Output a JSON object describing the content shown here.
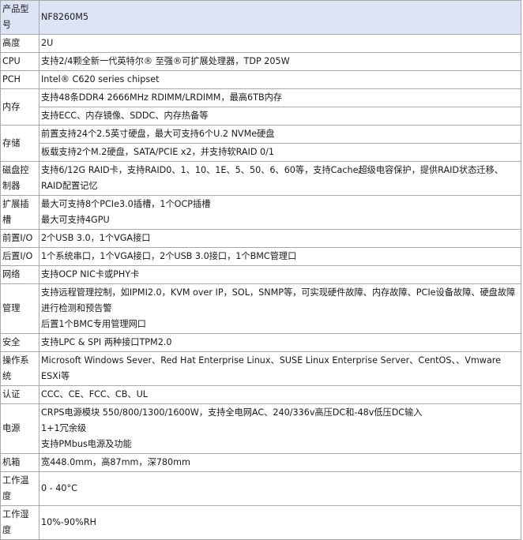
{
  "header": {
    "label": "产品型号",
    "value": "NF8260M5"
  },
  "rows": [
    {
      "label": "高度",
      "cells": [
        [
          "2U"
        ]
      ]
    },
    {
      "label": "CPU",
      "cells": [
        [
          "支持2/4颗全新一代英特尔® 至强®可扩展处理器，TDP 205W"
        ]
      ]
    },
    {
      "label": "PCH",
      "cells": [
        [
          "Intel® C620 series chipset"
        ]
      ]
    },
    {
      "label": "内存",
      "cells": [
        [
          "支持48条DDR4 2666MHz  RDIMM/LRDIMM，最高6TB内存"
        ],
        [
          "支持ECC、内存镜像、SDDC、内存热备等"
        ]
      ]
    },
    {
      "label": "存储",
      "cells": [
        [
          "前置支持24个2.5英寸硬盘，最大可支持6个U.2 NVMe硬盘"
        ],
        [
          "板载支持2个M.2硬盘，SATA/PCIE x2，并支持软RAID 0/1"
        ]
      ]
    },
    {
      "label": "磁盘控制器",
      "cells": [
        [
          "支持6/12G RAID卡，支持RAID0、1、10、1E、5、50、6、60等，支持Cache超级电容保护，提供RAID状态迁移、RAID配置记忆"
        ]
      ]
    },
    {
      "label": "扩展插槽",
      "cells": [
        [
          "最大可支持8个PCIe3.0插槽，1个OCP插槽",
          "最大可支持4GPU"
        ]
      ]
    },
    {
      "label": "前置I/O",
      "cells": [
        [
          "2个USB 3.0，1个VGA接口"
        ]
      ]
    },
    {
      "label": "后置I/O",
      "cells": [
        [
          "1个系统串口，1个VGA接口，2个USB 3.0接口，1个BMC管理口"
        ]
      ]
    },
    {
      "label": "网络",
      "cells": [
        [
          "支持OCP NIC卡或PHY卡"
        ]
      ]
    },
    {
      "label": "管理",
      "cells": [
        [
          "支持远程管理控制，如IPMI2.0，KVM over IP，SOL，SNMP等，可实现硬件故障、内存故障、PCIe设备故障、硬盘故障进行检测和预告警",
          "后置1个BMC专用管理网口"
        ]
      ]
    },
    {
      "label": "安全",
      "cells": [
        [
          "支持LPC & SPI 两种接口TPM2.0"
        ]
      ]
    },
    {
      "label": "操作系统",
      "cells": [
        [
          "Microsoft Windows Sever、Red Hat Enterprise Linux、SUSE Linux Enterprise Server、CentOS、、Vmware ESXi等"
        ]
      ]
    },
    {
      "label": "认证",
      "cells": [
        [
          "CCC、CE、FCC、CB、UL"
        ]
      ]
    },
    {
      "label": "电源",
      "cells": [
        [
          "CRPS电源模块 550/800/1300/1600W，支持全电网AC、240/336v高压DC和-48v低压DC输入",
          "1+1冗余级",
          "支持PMbus电源及功能"
        ]
      ]
    },
    {
      "label": "机箱",
      "cells": [
        [
          "宽448.0mm，高87mm，深780mm"
        ]
      ]
    },
    {
      "label": "工作温度",
      "cells": [
        [
          "0 - 40°C"
        ]
      ]
    },
    {
      "label": "工作湿度",
      "cells": [
        [
          "10%-90%RH"
        ]
      ]
    }
  ]
}
